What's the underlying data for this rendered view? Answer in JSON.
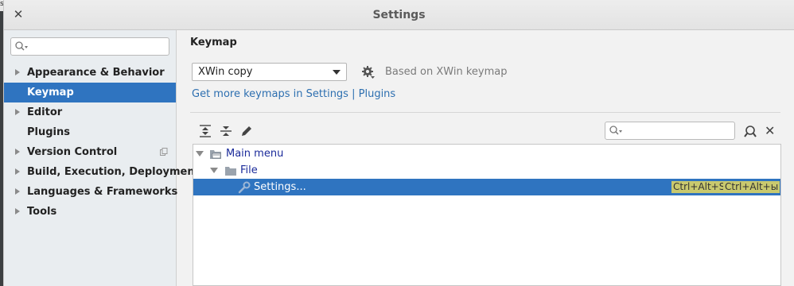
{
  "window": {
    "title": "Settings"
  },
  "left_edge_fragment": "s",
  "sidebar": {
    "search_placeholder": "",
    "items": [
      {
        "label": "Appearance & Behavior",
        "expandable": true,
        "selected": false
      },
      {
        "label": "Keymap",
        "expandable": false,
        "selected": true
      },
      {
        "label": "Editor",
        "expandable": true,
        "selected": false
      },
      {
        "label": "Plugins",
        "expandable": false,
        "selected": false
      },
      {
        "label": "Version Control",
        "expandable": true,
        "selected": false,
        "project_icon": "copy-icon"
      },
      {
        "label": "Build, Execution, Deployment",
        "expandable": true,
        "selected": false
      },
      {
        "label": "Languages & Frameworks",
        "expandable": true,
        "selected": false
      },
      {
        "label": "Tools",
        "expandable": true,
        "selected": false
      }
    ]
  },
  "main": {
    "title": "Keymap",
    "keymap_select": {
      "value": "XWin copy"
    },
    "based_on": "Based on XWin keymap",
    "links": {
      "get_more": "Get more keymaps in Settings",
      "separator": " | ",
      "plugins": "Plugins"
    },
    "toolbar": {
      "expand_all_icon": "expand-all-icon",
      "collapse_all_icon": "collapse-all-icon",
      "edit_icon": "pencil-icon",
      "search_placeholder": "",
      "find_by_shortcut_icon": "find-shortcut-icon",
      "close_icon": "close-icon"
    },
    "tree": [
      {
        "label": "Main menu",
        "level": 0,
        "expanded": true,
        "icon": "menu-folder-icon"
      },
      {
        "label": "File",
        "level": 1,
        "expanded": true,
        "icon": "folder-icon"
      },
      {
        "label": "Settings...",
        "level": 2,
        "selected": true,
        "icon": "wrench-icon",
        "shortcuts": [
          "Ctrl+Alt+S",
          "Ctrl+Alt+ы"
        ]
      }
    ]
  },
  "colors": {
    "selection": "#2f74c0",
    "link": "#2d6fb0",
    "shortcut_highlight": "#c9c96e",
    "sidebar_bg": "#e9edf0"
  }
}
